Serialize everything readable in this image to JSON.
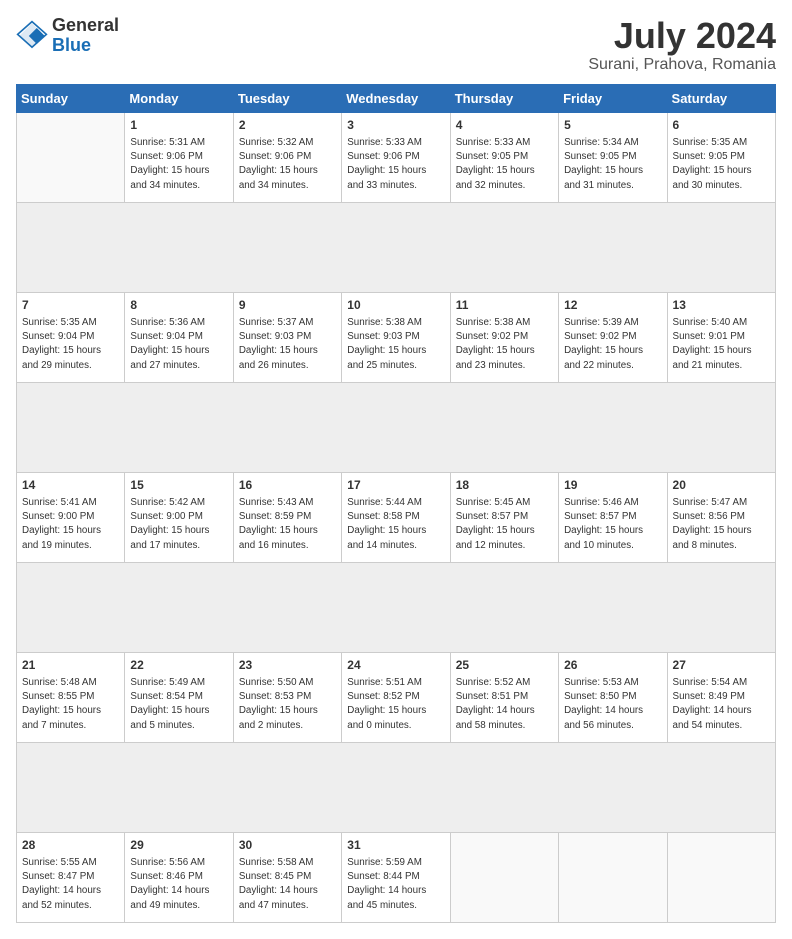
{
  "logo": {
    "line1": "General",
    "line2": "Blue"
  },
  "title": "July 2024",
  "subtitle": "Surani, Prahova, Romania",
  "days_header": [
    "Sunday",
    "Monday",
    "Tuesday",
    "Wednesday",
    "Thursday",
    "Friday",
    "Saturday"
  ],
  "weeks": [
    [
      {
        "day": "",
        "info": ""
      },
      {
        "day": "1",
        "info": "Sunrise: 5:31 AM\nSunset: 9:06 PM\nDaylight: 15 hours\nand 34 minutes."
      },
      {
        "day": "2",
        "info": "Sunrise: 5:32 AM\nSunset: 9:06 PM\nDaylight: 15 hours\nand 34 minutes."
      },
      {
        "day": "3",
        "info": "Sunrise: 5:33 AM\nSunset: 9:06 PM\nDaylight: 15 hours\nand 33 minutes."
      },
      {
        "day": "4",
        "info": "Sunrise: 5:33 AM\nSunset: 9:05 PM\nDaylight: 15 hours\nand 32 minutes."
      },
      {
        "day": "5",
        "info": "Sunrise: 5:34 AM\nSunset: 9:05 PM\nDaylight: 15 hours\nand 31 minutes."
      },
      {
        "day": "6",
        "info": "Sunrise: 5:35 AM\nSunset: 9:05 PM\nDaylight: 15 hours\nand 30 minutes."
      }
    ],
    [
      {
        "day": "7",
        "info": "Sunrise: 5:35 AM\nSunset: 9:04 PM\nDaylight: 15 hours\nand 29 minutes."
      },
      {
        "day": "8",
        "info": "Sunrise: 5:36 AM\nSunset: 9:04 PM\nDaylight: 15 hours\nand 27 minutes."
      },
      {
        "day": "9",
        "info": "Sunrise: 5:37 AM\nSunset: 9:03 PM\nDaylight: 15 hours\nand 26 minutes."
      },
      {
        "day": "10",
        "info": "Sunrise: 5:38 AM\nSunset: 9:03 PM\nDaylight: 15 hours\nand 25 minutes."
      },
      {
        "day": "11",
        "info": "Sunrise: 5:38 AM\nSunset: 9:02 PM\nDaylight: 15 hours\nand 23 minutes."
      },
      {
        "day": "12",
        "info": "Sunrise: 5:39 AM\nSunset: 9:02 PM\nDaylight: 15 hours\nand 22 minutes."
      },
      {
        "day": "13",
        "info": "Sunrise: 5:40 AM\nSunset: 9:01 PM\nDaylight: 15 hours\nand 21 minutes."
      }
    ],
    [
      {
        "day": "14",
        "info": "Sunrise: 5:41 AM\nSunset: 9:00 PM\nDaylight: 15 hours\nand 19 minutes."
      },
      {
        "day": "15",
        "info": "Sunrise: 5:42 AM\nSunset: 9:00 PM\nDaylight: 15 hours\nand 17 minutes."
      },
      {
        "day": "16",
        "info": "Sunrise: 5:43 AM\nSunset: 8:59 PM\nDaylight: 15 hours\nand 16 minutes."
      },
      {
        "day": "17",
        "info": "Sunrise: 5:44 AM\nSunset: 8:58 PM\nDaylight: 15 hours\nand 14 minutes."
      },
      {
        "day": "18",
        "info": "Sunrise: 5:45 AM\nSunset: 8:57 PM\nDaylight: 15 hours\nand 12 minutes."
      },
      {
        "day": "19",
        "info": "Sunrise: 5:46 AM\nSunset: 8:57 PM\nDaylight: 15 hours\nand 10 minutes."
      },
      {
        "day": "20",
        "info": "Sunrise: 5:47 AM\nSunset: 8:56 PM\nDaylight: 15 hours\nand 8 minutes."
      }
    ],
    [
      {
        "day": "21",
        "info": "Sunrise: 5:48 AM\nSunset: 8:55 PM\nDaylight: 15 hours\nand 7 minutes."
      },
      {
        "day": "22",
        "info": "Sunrise: 5:49 AM\nSunset: 8:54 PM\nDaylight: 15 hours\nand 5 minutes."
      },
      {
        "day": "23",
        "info": "Sunrise: 5:50 AM\nSunset: 8:53 PM\nDaylight: 15 hours\nand 2 minutes."
      },
      {
        "day": "24",
        "info": "Sunrise: 5:51 AM\nSunset: 8:52 PM\nDaylight: 15 hours\nand 0 minutes."
      },
      {
        "day": "25",
        "info": "Sunrise: 5:52 AM\nSunset: 8:51 PM\nDaylight: 14 hours\nand 58 minutes."
      },
      {
        "day": "26",
        "info": "Sunrise: 5:53 AM\nSunset: 8:50 PM\nDaylight: 14 hours\nand 56 minutes."
      },
      {
        "day": "27",
        "info": "Sunrise: 5:54 AM\nSunset: 8:49 PM\nDaylight: 14 hours\nand 54 minutes."
      }
    ],
    [
      {
        "day": "28",
        "info": "Sunrise: 5:55 AM\nSunset: 8:47 PM\nDaylight: 14 hours\nand 52 minutes."
      },
      {
        "day": "29",
        "info": "Sunrise: 5:56 AM\nSunset: 8:46 PM\nDaylight: 14 hours\nand 49 minutes."
      },
      {
        "day": "30",
        "info": "Sunrise: 5:58 AM\nSunset: 8:45 PM\nDaylight: 14 hours\nand 47 minutes."
      },
      {
        "day": "31",
        "info": "Sunrise: 5:59 AM\nSunset: 8:44 PM\nDaylight: 14 hours\nand 45 minutes."
      },
      {
        "day": "",
        "info": ""
      },
      {
        "day": "",
        "info": ""
      },
      {
        "day": "",
        "info": ""
      }
    ]
  ]
}
